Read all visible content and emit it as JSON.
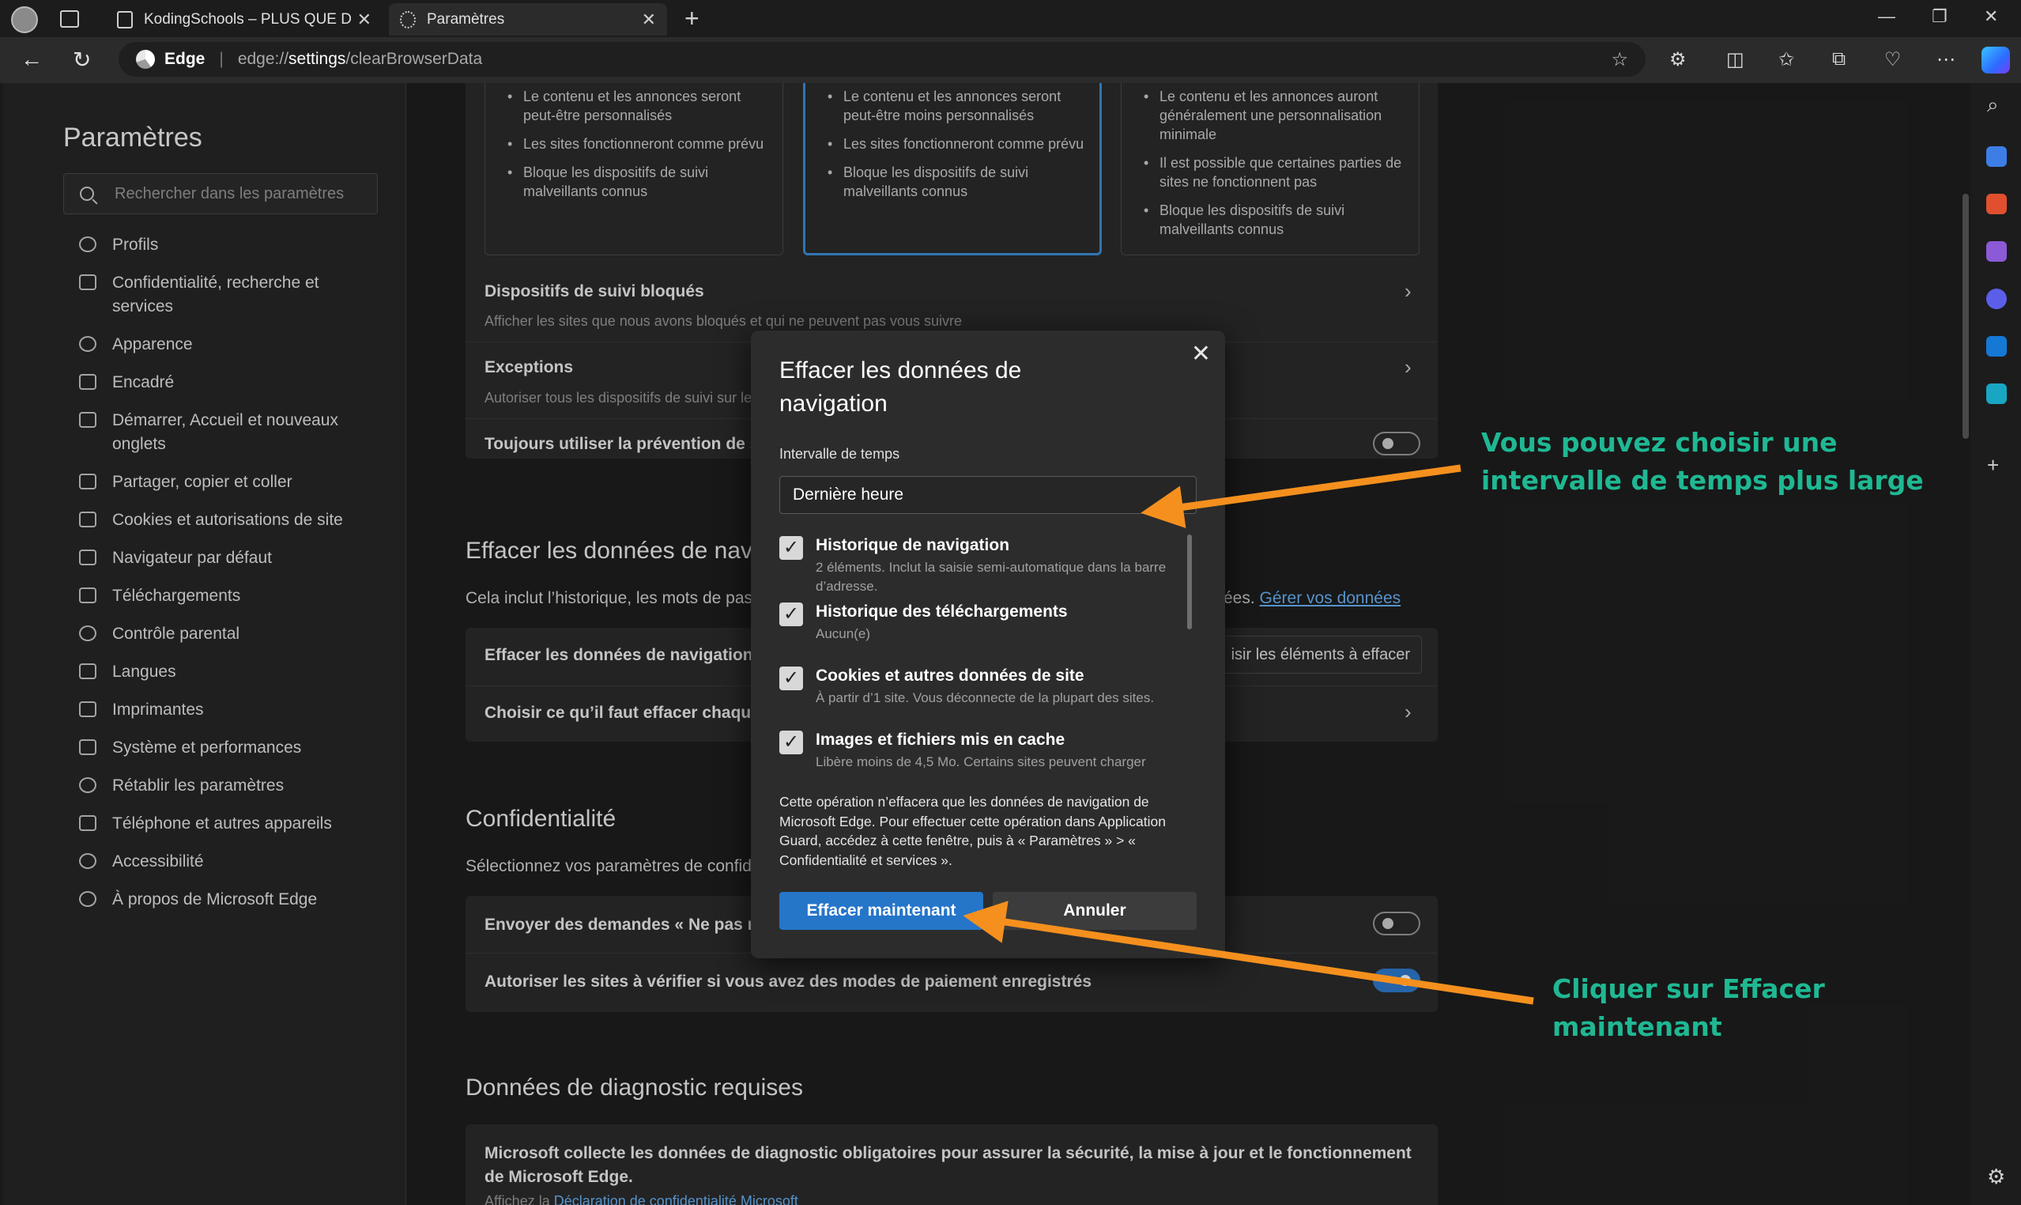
{
  "tabs": [
    {
      "label": "KodingSchools – PLUS QUE DU C",
      "icon": "page-icon"
    },
    {
      "label": "Paramètres",
      "icon": "gear-icon"
    }
  ],
  "address": {
    "brand": "Edge",
    "url_prefix": "edge://",
    "url_bold": "settings",
    "url_rest": "/clearBrowserData"
  },
  "sidebar": {
    "title": "Paramètres",
    "search_placeholder": "Rechercher dans les paramètres",
    "items": [
      "Profils",
      "Confidentialité, recherche et services",
      "Apparence",
      "Encadré",
      "Démarrer, Accueil et nouveaux onglets",
      "Partager, copier et coller",
      "Cookies et autorisations de site",
      "Navigateur par défaut",
      "Téléchargements",
      "Contrôle parental",
      "Langues",
      "Imprimantes",
      "Système et performances",
      "Rétablir les paramètres",
      "Téléphone et autres appareils",
      "Accessibilité",
      "À propos de Microsoft Edge"
    ]
  },
  "tracking_cards": [
    [
      "Le contenu et les annonces seront peut-être personnalisés",
      "Les sites fonctionneront comme prévu",
      "Bloque les dispositifs de suivi malveillants connus"
    ],
    [
      "Le contenu et les annonces seront peut-être moins personnalisés",
      "Les sites fonctionneront comme prévu",
      "Bloque les dispositifs de suivi malveillants connus"
    ],
    [
      "Le contenu et les annonces auront généralement une personnalisation minimale",
      "Il est possible que certaines parties de sites ne fonctionnent pas",
      "Bloque les dispositifs de suivi malveillants connus"
    ]
  ],
  "main": {
    "blocked_title": "Dispositifs de suivi bloqués",
    "blocked_sub": "Afficher les sites que nous avons bloqués et qui ne peuvent pas vous suivre",
    "exceptions_title": "Exceptions",
    "exceptions_sub": "Autoriser tous les dispositifs de suivi sur le",
    "always_label": "Toujours utiliser la prévention de su",
    "clear_heading": "Effacer les données de nav",
    "clear_desc": "Cela inclut l’historique, les mots de pas",
    "clear_desc_tail": "ées.",
    "manage_link": "Gérer vos données",
    "clear_now_label": "Effacer les données de navigation n",
    "choose_button": "isir les éléments à effacer",
    "choose_each_label": "Choisir ce qu’il faut effacer chaque",
    "privacy_heading": "Confidentialité",
    "privacy_desc": "Sélectionnez vos paramètres de confide",
    "dnt_label": "Envoyer des demandes « Ne pas me",
    "payment_label": "Autoriser les sites à vérifier si vous avez des modes de paiement enregistrés",
    "diag_heading": "Données de diagnostic requises",
    "diag_text": "Microsoft collecte les données de diagnostic obligatoires pour assurer la sécurité, la mise à jour et le fonctionnement de Microsoft Edge.",
    "diag_sub": "Affichez la",
    "diag_link": "Déclaration de confidentialité Microsoft"
  },
  "dialog": {
    "title": "Effacer les données de navigation",
    "range_label": "Intervalle de temps",
    "range_value": "Dernière heure",
    "options": [
      {
        "title": "Historique de navigation",
        "desc": "2 éléments. Inclut la saisie semi-automatique dans la barre d’adresse.",
        "checked": true
      },
      {
        "title": "Historique des téléchargements",
        "desc": "Aucun(e)",
        "checked": true
      },
      {
        "title": "Cookies et autres données de site",
        "desc": "À partir d’1 site. Vous déconnecte de la plupart des sites.",
        "checked": true
      },
      {
        "title": "Images et fichiers mis en cache",
        "desc": "Libère moins de 4,5 Mo. Certains sites peuvent charger",
        "checked": true
      }
    ],
    "note": "Cette opération n’effacera que les données de navigation de Microsoft Edge. Pour effectuer cette opération dans Application Guard, accédez à cette fenêtre, puis à « Paramètres » > « Confidentialité et services ».",
    "primary": "Effacer maintenant",
    "secondary": "Annuler"
  },
  "annotations": {
    "top": "Vous pouvez choisir une intervalle de temps plus large",
    "bottom": "Cliquer sur Effacer maintenant",
    "color": "#1fb893",
    "arrow_color": "#f5901e"
  }
}
